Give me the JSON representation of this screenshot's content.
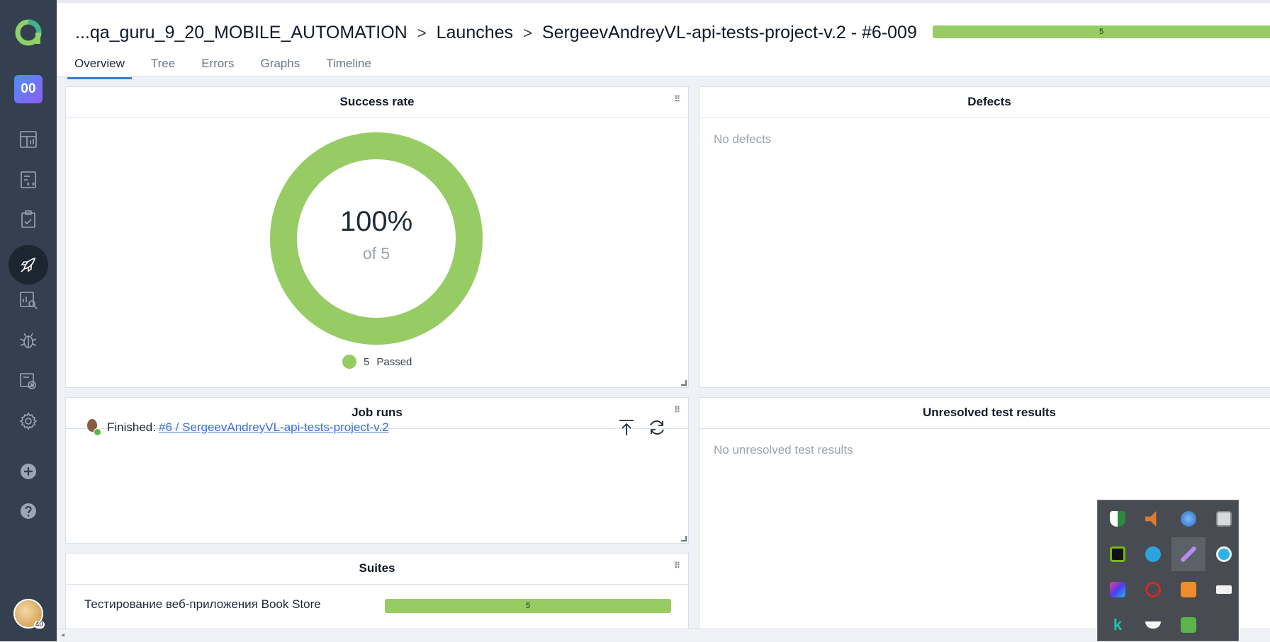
{
  "breadcrumb": {
    "project": "...qa_guru_9_20_MOBILE_AUTOMATION",
    "section": "Launches",
    "launch": "SergeevAndreyVL-api-tests-project-v.2 - #6-009",
    "separator": ">"
  },
  "header_progress": {
    "passed_count": "5"
  },
  "sidebar": {
    "project_badge": "00",
    "avatar_badge": "40"
  },
  "tabs": [
    "Overview",
    "Tree",
    "Errors",
    "Graphs",
    "Timeline"
  ],
  "active_tab": "Overview",
  "success_rate": {
    "title": "Success rate",
    "percent_text": "100%",
    "of_text": "of 5",
    "legend_count": "5",
    "legend_label": "Passed",
    "passed_fraction": 1.0,
    "color": "#97cc64"
  },
  "defects": {
    "title": "Defects",
    "empty_text": "No defects"
  },
  "job_runs": {
    "title": "Job runs",
    "status_label": "Finished:",
    "link_text": "#6 / SergeevAndreyVL-api-tests-project-v.2"
  },
  "unresolved": {
    "title": "Unresolved test results",
    "empty_text": "No unresolved test results"
  },
  "suites": {
    "title": "Suites",
    "rows": [
      {
        "name": "Тестирование веб-приложения Book Store",
        "count": "5"
      }
    ]
  },
  "icons": [
    "allure-logo",
    "dashboards-icon",
    "test-cases-icon",
    "test-plans-icon",
    "launches-icon",
    "analytics-icon",
    "defects-icon",
    "jobs-icon",
    "settings-icon",
    "add-icon",
    "help-icon"
  ],
  "tray_icons": [
    "windows-security-icon",
    "volume-icon",
    "network-globe-icon",
    "keyboard-icon",
    "nvidia-icon",
    "telegram-icon",
    "feather-icon",
    "bluetooth-icon",
    "intellij-icon",
    "antivirus-icon",
    "sublime-icon",
    "battery-icon",
    "kaspersky-icon",
    "docker-whale-icon",
    "check-shield-icon"
  ]
}
